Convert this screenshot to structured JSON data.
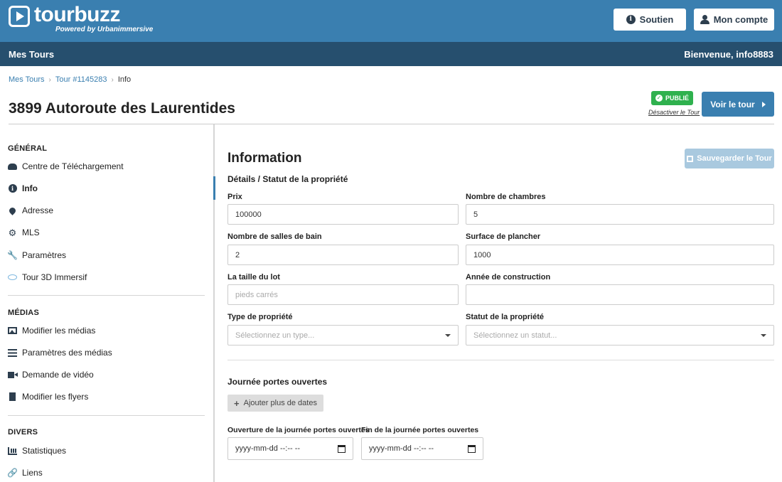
{
  "header": {
    "logo_name": "tourbuzz",
    "logo_sub": "Powered by Urbanimmersive",
    "support_label": "Soutien",
    "account_label": "Mon compte"
  },
  "subnav": {
    "left": "Mes Tours",
    "right": "Bienvenue, info8883"
  },
  "breadcrumb": [
    "Mes Tours",
    "Tour #1145283",
    "Info"
  ],
  "page": {
    "title": "3899 Autoroute des Laurentides",
    "status_badge": "PUBLIÉ",
    "deactivate_link": "Désactiver le Tour",
    "view_button": "Voir le tour"
  },
  "sidebar": {
    "sections": [
      {
        "title": "GÉNÉRAL",
        "items": [
          {
            "label": "Centre de Téléchargement",
            "icon": "cloud-download-icon"
          },
          {
            "label": "Info",
            "icon": "info-icon",
            "active": true
          },
          {
            "label": "Adresse",
            "icon": "map-pin-icon"
          },
          {
            "label": "MLS",
            "icon": "gear-icon"
          },
          {
            "label": "Paramètres",
            "icon": "wrench-icon"
          },
          {
            "label": "Tour 3D Immersif",
            "icon": "3d-tour-icon"
          }
        ]
      },
      {
        "title": "MÉDIAS",
        "items": [
          {
            "label": "Modifier les médias",
            "icon": "image-icon"
          },
          {
            "label": "Paramètres des médias",
            "icon": "sliders-icon"
          },
          {
            "label": "Demande de vidéo",
            "icon": "video-icon"
          },
          {
            "label": "Modifier les flyers",
            "icon": "file-icon"
          }
        ]
      },
      {
        "title": "DIVERS",
        "items": [
          {
            "label": "Statistiques",
            "icon": "bar-chart-icon"
          },
          {
            "label": "Liens",
            "icon": "link-icon"
          }
        ]
      }
    ]
  },
  "main": {
    "title": "Information",
    "save_button": "Sauvegarder le Tour",
    "subheading": "Détails / Statut de la propriété",
    "fields": {
      "price": {
        "label": "Prix",
        "value": "100000",
        "placeholder": ""
      },
      "bedrooms": {
        "label": "Nombre de chambres",
        "value": "5",
        "placeholder": ""
      },
      "bathrooms": {
        "label": "Nombre de salles de bain",
        "value": "2",
        "placeholder": ""
      },
      "floor_area": {
        "label": "Surface de plancher",
        "value": "1000",
        "placeholder": ""
      },
      "lot_size": {
        "label": "La taille du lot",
        "value": "",
        "placeholder": "pieds carrés"
      },
      "year_built": {
        "label": "Année de construction",
        "value": "",
        "placeholder": ""
      },
      "property_type": {
        "label": "Type de propriété",
        "placeholder": "Sélectionnez un type..."
      },
      "property_status": {
        "label": "Statut de la propriété",
        "placeholder": "Sélectionnez un statut..."
      }
    },
    "open_house": {
      "title": "Journée portes ouvertes",
      "add_button": "Ajouter plus de dates",
      "start_label": "Ouverture de la journée portes ouvertes",
      "end_label": "Fin de la journée portes ouvertes",
      "start_placeholder": "yyyy-mm-dd --:-- --",
      "end_placeholder": "yyyy-mm-dd --:-- --"
    }
  },
  "colors": {
    "header_bg": "#3a7fb0",
    "subnav_bg": "#264f6e",
    "published_green": "#2fb14e",
    "save_disabled": "#a9c9df"
  }
}
